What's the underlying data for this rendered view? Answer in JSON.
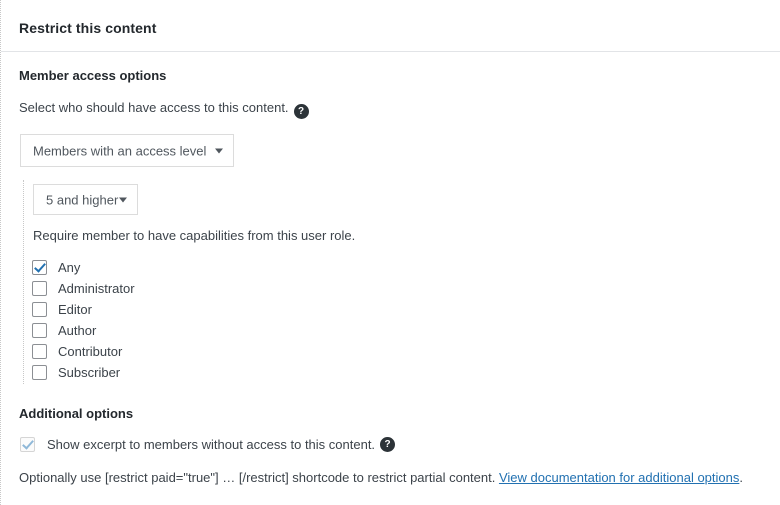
{
  "panel": {
    "title": "Restrict this content"
  },
  "member_access": {
    "heading": "Member access options",
    "description": "Select who should have access to this content.",
    "help_icon": "help-circle-icon",
    "help_glyph": "?",
    "access_select": {
      "value": "Members with an access level",
      "arrow_icon": "chevron-down-icon"
    },
    "level_select": {
      "value": "5 and higher",
      "arrow_icon": "chevron-down-icon"
    },
    "capability_note": "Require member to have capabilities from this user role.",
    "roles": [
      {
        "label": "Any",
        "checked": true
      },
      {
        "label": "Administrator",
        "checked": false
      },
      {
        "label": "Editor",
        "checked": false
      },
      {
        "label": "Author",
        "checked": false
      },
      {
        "label": "Contributor",
        "checked": false
      },
      {
        "label": "Subscriber",
        "checked": false
      }
    ]
  },
  "additional_options": {
    "heading": "Additional options",
    "excerpt": {
      "label": "Show excerpt to members without access to this content.",
      "checked": true,
      "disabled": true,
      "help_icon": "help-circle-icon",
      "help_glyph": "?"
    },
    "shortcode_text_before": "Optionally use [restrict paid=\"true\"] … [/restrict] shortcode to restrict partial content. ",
    "doc_link_text": "View documentation for additional options",
    "shortcode_text_after": "."
  },
  "colors": {
    "accent": "#2271b1",
    "text": "#3c434a",
    "heading": "#23282d",
    "border": "#dcdcdc",
    "divider": "#e2e4e7",
    "disabled_check": "#8fb8d8"
  }
}
